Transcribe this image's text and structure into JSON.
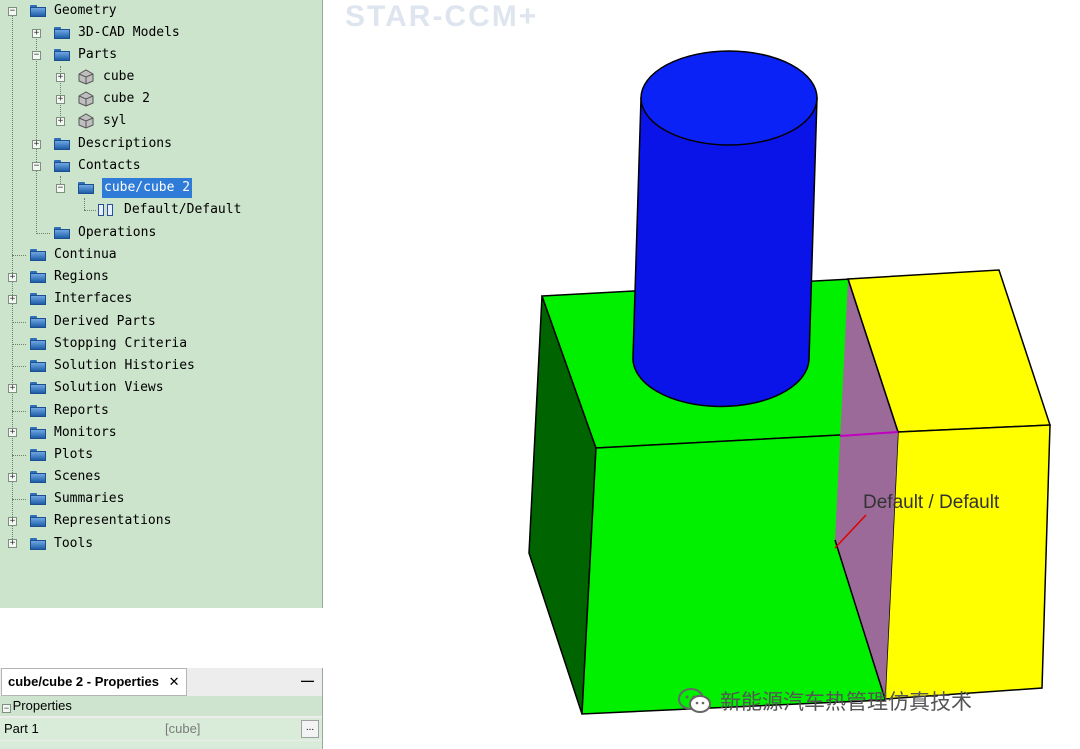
{
  "tree": {
    "items": [
      {
        "label": "Geometry"
      },
      {
        "label": "3D-CAD Models"
      },
      {
        "label": "Parts"
      },
      {
        "label": "cube"
      },
      {
        "label": "cube 2"
      },
      {
        "label": "syl"
      },
      {
        "label": "Descriptions"
      },
      {
        "label": "Contacts"
      },
      {
        "label": "cube/cube 2"
      },
      {
        "label": "Default/Default"
      },
      {
        "label": "Operations"
      },
      {
        "label": "Continua"
      },
      {
        "label": "Regions"
      },
      {
        "label": "Interfaces"
      },
      {
        "label": "Derived Parts"
      },
      {
        "label": "Stopping Criteria"
      },
      {
        "label": "Solution Histories"
      },
      {
        "label": "Solution Views"
      },
      {
        "label": "Reports"
      },
      {
        "label": "Monitors"
      },
      {
        "label": "Plots"
      },
      {
        "label": "Scenes"
      },
      {
        "label": "Summaries"
      },
      {
        "label": "Representations"
      },
      {
        "label": "Tools"
      }
    ]
  },
  "properties": {
    "tab_title": "cube/cube 2 - Properties",
    "close_glyph": "✕",
    "minimize_glyph": "—",
    "section": "Properties",
    "row1_name": "Part 1",
    "row1_value": "[cube]",
    "ellipsis": "..."
  },
  "viewport": {
    "logo_text": "STAR-CCM+",
    "contact_label": "Default / Default",
    "wechat_text": "新能源汽车热管理仿真技术",
    "colors": {
      "cylinder": "#0a14e8",
      "cube": "#00f000",
      "cube_2": "#ffff00",
      "contact_interface": "#9b6a98"
    }
  },
  "icons": [
    "folder-icon",
    "part-icon",
    "contact-icon",
    "wechat-icon"
  ]
}
